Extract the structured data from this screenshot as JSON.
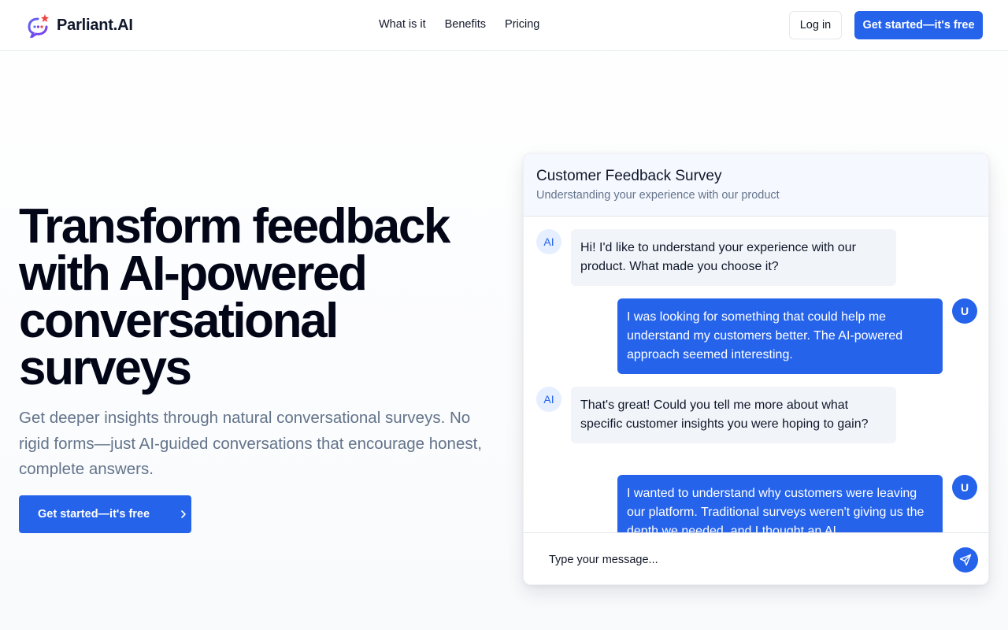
{
  "header": {
    "brand": "Parliant.AI",
    "nav": [
      "What is it",
      "Benefits",
      "Pricing"
    ],
    "login_label": "Log in",
    "cta_label": "Get started—it's free"
  },
  "hero": {
    "title": "Transform feedback with AI-powered conversational surveys",
    "subtitle": "Get deeper insights through natural conversational surveys. No rigid forms—just AI-guided conversations that encourage honest, complete answers.",
    "cta_label": "Get started—it's free"
  },
  "chat": {
    "title": "Customer Feedback Survey",
    "description": "Understanding your experience with our product",
    "ai_avatar": "AI",
    "user_avatar": "U",
    "messages": [
      {
        "from": "ai",
        "text": "Hi! I'd like to understand your experience with our product. What made you choose it?"
      },
      {
        "from": "user",
        "text": "I was looking for something that could help me understand my customers better. The AI-powered approach seemed interesting."
      },
      {
        "from": "ai",
        "text": "That's great! Could you tell me more about what specific customer insights you were hoping to gain?"
      },
      {
        "from": "user",
        "text": "I wanted to understand why customers were leaving our platform. Traditional surveys weren't giving us the depth we needed, and I thought an AI"
      }
    ],
    "input_placeholder": "Type your message..."
  },
  "colors": {
    "primary": "#2563eb",
    "text_dark": "#020617",
    "text_muted": "#64748b",
    "bubble_ai": "#f1f4f8"
  },
  "icons": {
    "logo": "speech-bubble-sparkle-icon",
    "hero_cta": "chevron-right-icon",
    "send": "send-paper-plane-icon"
  }
}
